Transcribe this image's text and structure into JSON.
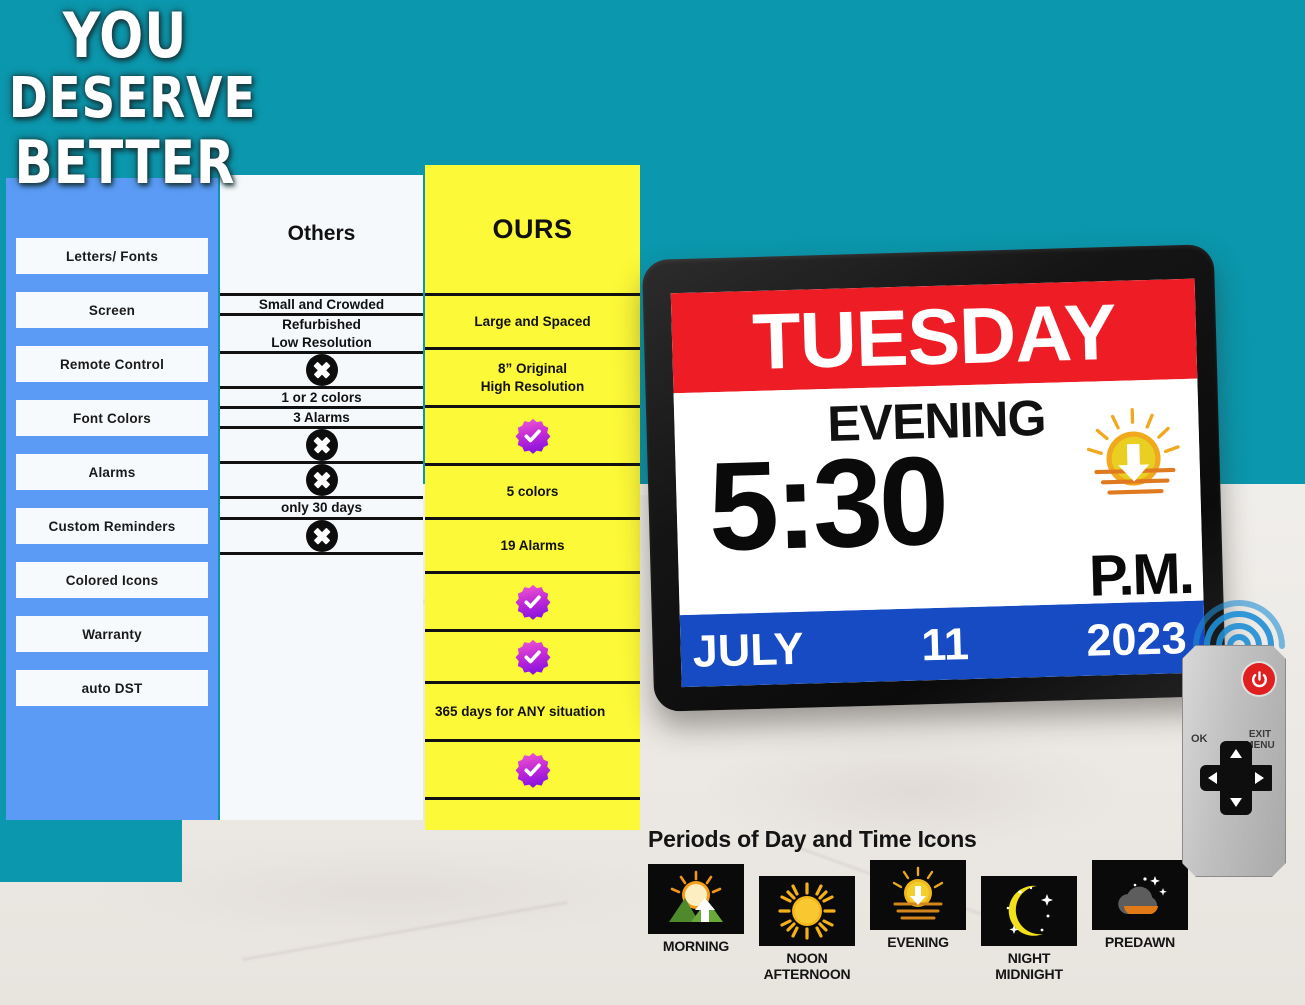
{
  "headline": {
    "line1": "YOU",
    "line2": "DESERVE",
    "line3": "BETTER"
  },
  "colors": {
    "teal_background": "#0b97ad",
    "panel_blue": "#5b9bf5",
    "ours_yellow": "#fcf938",
    "others_white": "#f5f9fc",
    "clock_red": "#ee1c25",
    "clock_blue": "#174bc4",
    "badge_pink": "#e838c8",
    "badge_purple": "#a020e0",
    "power_red": "#e02020"
  },
  "features": [
    {
      "label": "Letters/ Fonts"
    },
    {
      "label": "Screen"
    },
    {
      "label": "Remote Control"
    },
    {
      "label": "Font Colors"
    },
    {
      "label": "Alarms"
    },
    {
      "label": "Custom Reminders"
    },
    {
      "label": "Colored Icons"
    },
    {
      "label": "Warranty"
    },
    {
      "label": "auto DST"
    }
  ],
  "comparison": {
    "others_header": "Others",
    "ours_header": "OURS",
    "rows": [
      {
        "others_text": "Small and Crowded",
        "others_icon": null,
        "ours_text": "Large and Spaced",
        "ours_icon": null
      },
      {
        "others_text": "Refurbished\nLow Resolution",
        "others_icon": null,
        "ours_text": "8” Original\nHigh Resolution",
        "ours_icon": null
      },
      {
        "others_text": null,
        "others_icon": "x-icon",
        "ours_text": null,
        "ours_icon": "check-badge-icon"
      },
      {
        "others_text": "1 or 2 colors",
        "others_icon": null,
        "ours_text": "5  colors",
        "ours_icon": null
      },
      {
        "others_text": "3 Alarms",
        "others_icon": null,
        "ours_text": "19 Alarms",
        "ours_icon": null
      },
      {
        "others_text": null,
        "others_icon": "x-icon",
        "ours_text": null,
        "ours_icon": "check-badge-icon"
      },
      {
        "others_text": null,
        "others_icon": "x-icon",
        "ours_text": null,
        "ours_icon": "check-badge-icon"
      },
      {
        "others_text": "only 30 days",
        "others_icon": null,
        "ours_text": "365 days for ANY situation",
        "ours_icon": null
      },
      {
        "others_text": null,
        "others_icon": "x-icon",
        "ours_text": null,
        "ours_icon": "check-badge-icon"
      }
    ]
  },
  "clock": {
    "weekday": "TUESDAY",
    "period": "EVENING",
    "time": "5:30",
    "ampm": "P.M.",
    "month": "JULY",
    "day": "11",
    "year": "2023",
    "screen_icon": "sunset-icon"
  },
  "remote": {
    "ok_label": "OK",
    "exit_label": "EXIT\nMENU",
    "power_icon": "power-icon",
    "dpad_icon": "dpad-icon",
    "signal_icon": "wireless-signal-icon"
  },
  "periods": {
    "title": "Periods of Day and Time Icons",
    "items": [
      {
        "label": "MORNING",
        "icon": "sunrise-mountains-icon"
      },
      {
        "label": "NOON\nAFTERNOON",
        "icon": "full-sun-icon"
      },
      {
        "label": "EVENING",
        "icon": "sunset-water-icon"
      },
      {
        "label": "NIGHT\nMIDNIGHT",
        "icon": "crescent-moon-stars-icon"
      },
      {
        "label": "PREDAWN",
        "icon": "cloud-stars-icon"
      }
    ]
  }
}
